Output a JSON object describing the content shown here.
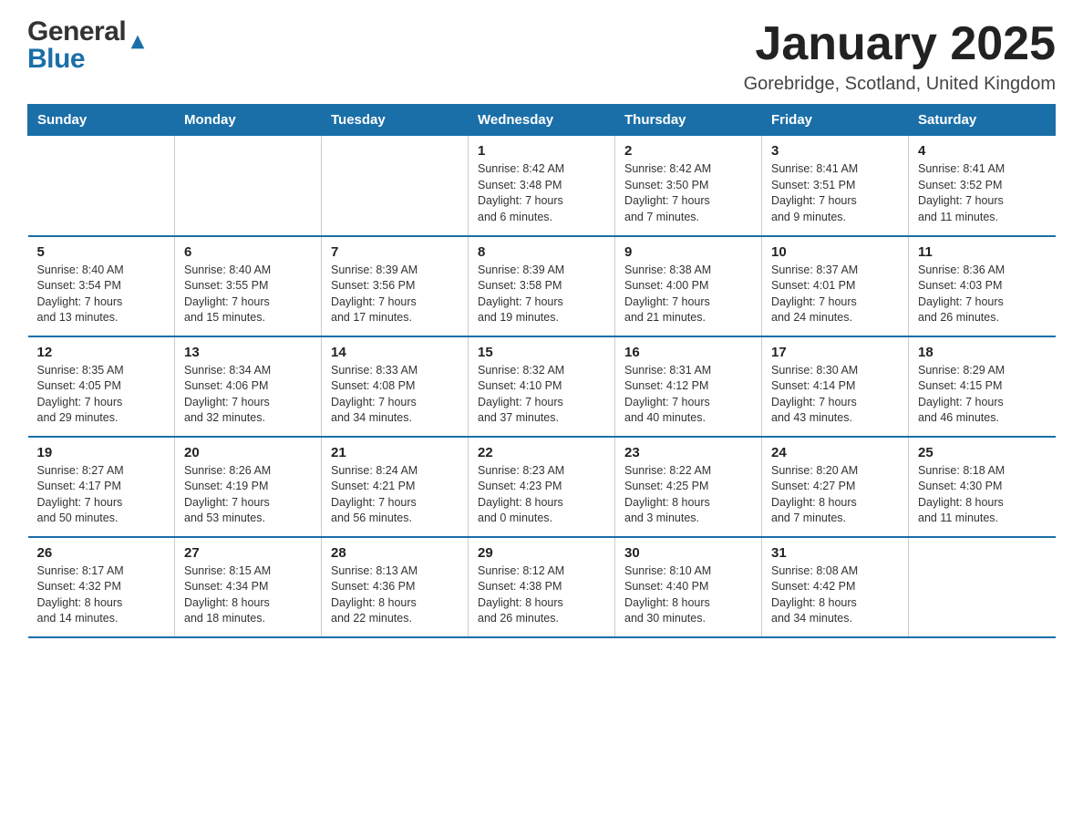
{
  "header": {
    "logo_general": "General",
    "logo_blue": "Blue",
    "title": "January 2025",
    "subtitle": "Gorebridge, Scotland, United Kingdom"
  },
  "days_of_week": [
    "Sunday",
    "Monday",
    "Tuesday",
    "Wednesday",
    "Thursday",
    "Friday",
    "Saturday"
  ],
  "weeks": [
    [
      {
        "day": "",
        "info": ""
      },
      {
        "day": "",
        "info": ""
      },
      {
        "day": "",
        "info": ""
      },
      {
        "day": "1",
        "info": "Sunrise: 8:42 AM\nSunset: 3:48 PM\nDaylight: 7 hours\nand 6 minutes."
      },
      {
        "day": "2",
        "info": "Sunrise: 8:42 AM\nSunset: 3:50 PM\nDaylight: 7 hours\nand 7 minutes."
      },
      {
        "day": "3",
        "info": "Sunrise: 8:41 AM\nSunset: 3:51 PM\nDaylight: 7 hours\nand 9 minutes."
      },
      {
        "day": "4",
        "info": "Sunrise: 8:41 AM\nSunset: 3:52 PM\nDaylight: 7 hours\nand 11 minutes."
      }
    ],
    [
      {
        "day": "5",
        "info": "Sunrise: 8:40 AM\nSunset: 3:54 PM\nDaylight: 7 hours\nand 13 minutes."
      },
      {
        "day": "6",
        "info": "Sunrise: 8:40 AM\nSunset: 3:55 PM\nDaylight: 7 hours\nand 15 minutes."
      },
      {
        "day": "7",
        "info": "Sunrise: 8:39 AM\nSunset: 3:56 PM\nDaylight: 7 hours\nand 17 minutes."
      },
      {
        "day": "8",
        "info": "Sunrise: 8:39 AM\nSunset: 3:58 PM\nDaylight: 7 hours\nand 19 minutes."
      },
      {
        "day": "9",
        "info": "Sunrise: 8:38 AM\nSunset: 4:00 PM\nDaylight: 7 hours\nand 21 minutes."
      },
      {
        "day": "10",
        "info": "Sunrise: 8:37 AM\nSunset: 4:01 PM\nDaylight: 7 hours\nand 24 minutes."
      },
      {
        "day": "11",
        "info": "Sunrise: 8:36 AM\nSunset: 4:03 PM\nDaylight: 7 hours\nand 26 minutes."
      }
    ],
    [
      {
        "day": "12",
        "info": "Sunrise: 8:35 AM\nSunset: 4:05 PM\nDaylight: 7 hours\nand 29 minutes."
      },
      {
        "day": "13",
        "info": "Sunrise: 8:34 AM\nSunset: 4:06 PM\nDaylight: 7 hours\nand 32 minutes."
      },
      {
        "day": "14",
        "info": "Sunrise: 8:33 AM\nSunset: 4:08 PM\nDaylight: 7 hours\nand 34 minutes."
      },
      {
        "day": "15",
        "info": "Sunrise: 8:32 AM\nSunset: 4:10 PM\nDaylight: 7 hours\nand 37 minutes."
      },
      {
        "day": "16",
        "info": "Sunrise: 8:31 AM\nSunset: 4:12 PM\nDaylight: 7 hours\nand 40 minutes."
      },
      {
        "day": "17",
        "info": "Sunrise: 8:30 AM\nSunset: 4:14 PM\nDaylight: 7 hours\nand 43 minutes."
      },
      {
        "day": "18",
        "info": "Sunrise: 8:29 AM\nSunset: 4:15 PM\nDaylight: 7 hours\nand 46 minutes."
      }
    ],
    [
      {
        "day": "19",
        "info": "Sunrise: 8:27 AM\nSunset: 4:17 PM\nDaylight: 7 hours\nand 50 minutes."
      },
      {
        "day": "20",
        "info": "Sunrise: 8:26 AM\nSunset: 4:19 PM\nDaylight: 7 hours\nand 53 minutes."
      },
      {
        "day": "21",
        "info": "Sunrise: 8:24 AM\nSunset: 4:21 PM\nDaylight: 7 hours\nand 56 minutes."
      },
      {
        "day": "22",
        "info": "Sunrise: 8:23 AM\nSunset: 4:23 PM\nDaylight: 8 hours\nand 0 minutes."
      },
      {
        "day": "23",
        "info": "Sunrise: 8:22 AM\nSunset: 4:25 PM\nDaylight: 8 hours\nand 3 minutes."
      },
      {
        "day": "24",
        "info": "Sunrise: 8:20 AM\nSunset: 4:27 PM\nDaylight: 8 hours\nand 7 minutes."
      },
      {
        "day": "25",
        "info": "Sunrise: 8:18 AM\nSunset: 4:30 PM\nDaylight: 8 hours\nand 11 minutes."
      }
    ],
    [
      {
        "day": "26",
        "info": "Sunrise: 8:17 AM\nSunset: 4:32 PM\nDaylight: 8 hours\nand 14 minutes."
      },
      {
        "day": "27",
        "info": "Sunrise: 8:15 AM\nSunset: 4:34 PM\nDaylight: 8 hours\nand 18 minutes."
      },
      {
        "day": "28",
        "info": "Sunrise: 8:13 AM\nSunset: 4:36 PM\nDaylight: 8 hours\nand 22 minutes."
      },
      {
        "day": "29",
        "info": "Sunrise: 8:12 AM\nSunset: 4:38 PM\nDaylight: 8 hours\nand 26 minutes."
      },
      {
        "day": "30",
        "info": "Sunrise: 8:10 AM\nSunset: 4:40 PM\nDaylight: 8 hours\nand 30 minutes."
      },
      {
        "day": "31",
        "info": "Sunrise: 8:08 AM\nSunset: 4:42 PM\nDaylight: 8 hours\nand 34 minutes."
      },
      {
        "day": "",
        "info": ""
      }
    ]
  ]
}
